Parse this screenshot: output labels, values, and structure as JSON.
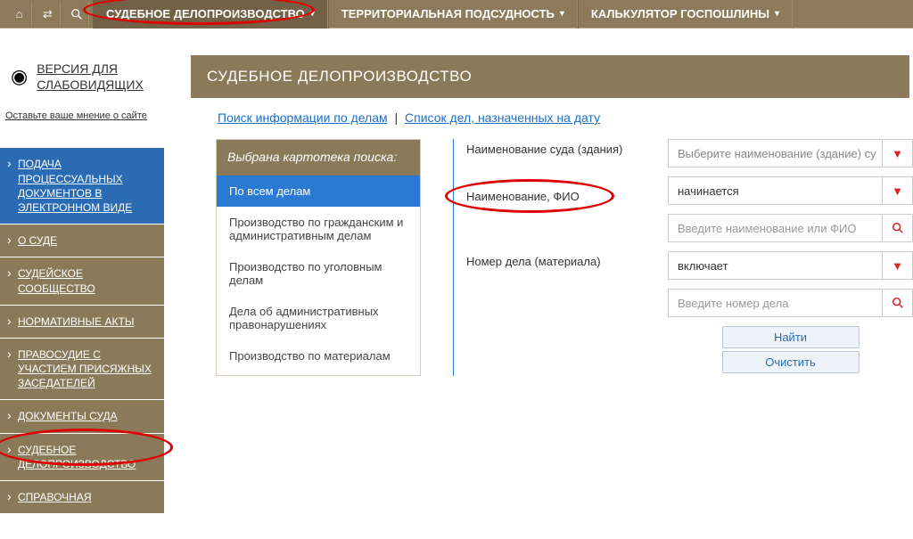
{
  "topnav": {
    "items": [
      {
        "label": "СУДЕБНОЕ ДЕЛОПРОИЗВОДСТВО"
      },
      {
        "label": "ТЕРРИТОРИАЛЬНАЯ ПОДСУДНОСТЬ"
      },
      {
        "label": "КАЛЬКУЛЯТОР ГОСПОШЛИНЫ"
      }
    ]
  },
  "accessibility": {
    "label": "ВЕРСИЯ ДЛЯ СЛАБОВИДЯЩИХ"
  },
  "feedback": {
    "label": "Оставьте ваше мнение о сайте"
  },
  "sidemenu": {
    "items": [
      {
        "label": "ПОДАЧА ПРОЦЕССУАЛЬНЫХ ДОКУМЕНТОВ В ЭЛЕКТРОННОМ ВИДЕ",
        "variant": "blue"
      },
      {
        "label": "О СУДЕ",
        "variant": "brown"
      },
      {
        "label": "СУДЕЙСКОЕ СООБЩЕСТВО",
        "variant": "brown"
      },
      {
        "label": "НОРМАТИВНЫЕ АКТЫ",
        "variant": "brown"
      },
      {
        "label": "ПРАВОСУДИЕ С УЧАСТИЕМ ПРИСЯЖНЫХ ЗАСЕДАТЕЛЕЙ",
        "variant": "brown"
      },
      {
        "label": "ДОКУМЕНТЫ СУДА",
        "variant": "brown"
      },
      {
        "label": "СУДЕБНОЕ ДЕЛОПРОИЗВОДСТВО",
        "variant": "brown"
      },
      {
        "label": "СПРАВОЧНАЯ",
        "variant": "brown"
      }
    ]
  },
  "page": {
    "title": "СУДЕБНОЕ ДЕЛОПРОИЗВОДСТВО",
    "link_search": "Поиск информации по делам",
    "link_list": "Список дел, назначенных на дату"
  },
  "cardbox": {
    "heading": "Выбрана картотека поиска:",
    "options": [
      "По всем делам",
      "Производство по гражданским и административным делам",
      "Производство по уголовным делам",
      "Дела об административных правонарушениях",
      "Производство по материалам"
    ]
  },
  "labels": {
    "court": "Наименование суда (здания)",
    "name": "Наименование, ФИО",
    "caseno": "Номер дела (материала)"
  },
  "form": {
    "court_placeholder": "Выберите наименование (здание) су",
    "name_mode": "начинается",
    "name_placeholder": "Введите наименование или ФИО",
    "case_mode": "включает",
    "case_placeholder": "Введите номер дела",
    "btn_find": "Найти",
    "btn_clear": "Очистить"
  }
}
